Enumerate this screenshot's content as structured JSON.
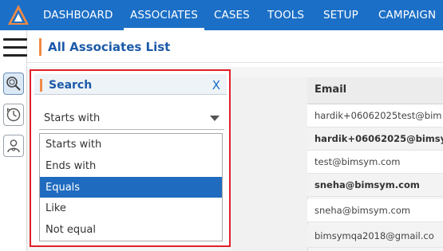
{
  "nav": {
    "logo_icon": "app-logo",
    "items": [
      "DASHBOARD",
      "ASSOCIATES",
      "CASES",
      "TOOLS",
      "SETUP",
      "CAMPAIGN"
    ],
    "active": "ASSOCIATES"
  },
  "rail": {
    "menu_icon": "hamburger-icon",
    "buttons": [
      "search-icon",
      "history-icon",
      "person-icon"
    ]
  },
  "page": {
    "title": "All Associates List"
  },
  "table": {
    "header": "Email",
    "rows": [
      {
        "email": "hardik+06062025test@bim",
        "bold": false
      },
      {
        "email": "hardik+06062025@bimsym",
        "bold": true
      },
      {
        "email": "test@bimsym.com",
        "bold": false
      },
      {
        "email": "sneha@bimsym.com",
        "bold": true
      },
      {
        "email": "sneha@bimsym.com",
        "bold": false
      },
      {
        "email": "bimsymqa2018@gmail.co",
        "bold": false
      }
    ]
  },
  "search": {
    "title": "Search",
    "close": "X",
    "selected_value": "Starts with",
    "options": [
      "Starts with",
      "Ends with",
      "Equals",
      "Like",
      "Not equal"
    ],
    "highlighted_option": "Equals"
  },
  "colors": {
    "nav_bg": "#1b6fc6",
    "accent": "#f08a45",
    "selected_option": "#1f6bbf",
    "popup_border": "#e0202a"
  }
}
